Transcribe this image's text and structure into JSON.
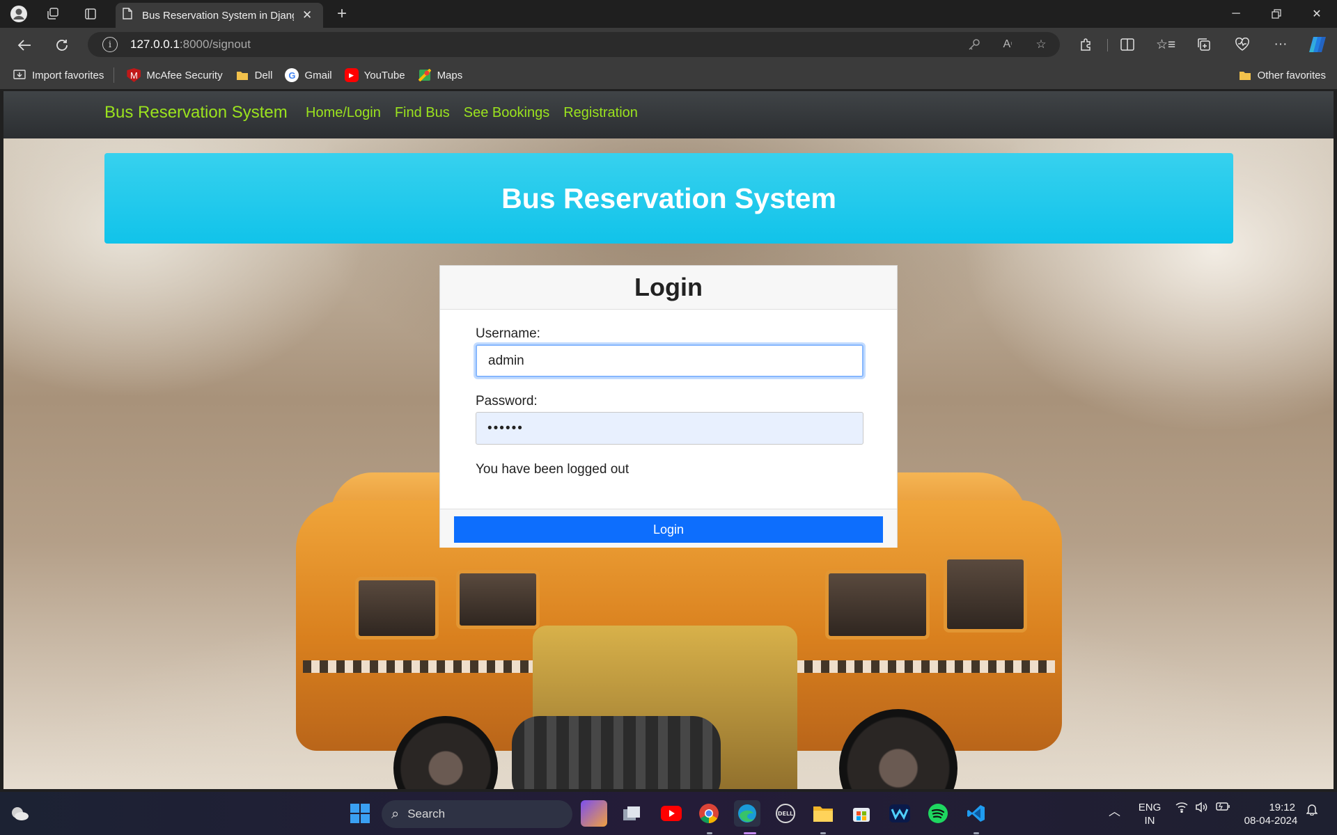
{
  "browser": {
    "tab_title": "Bus Reservation System in Djang",
    "url_host": "127.0.0.1",
    "url_rest": ":8000/signout",
    "favorites": [
      {
        "label": "Import favorites",
        "icon": "import-icon"
      },
      {
        "label": "McAfee Security",
        "icon": "mcafee-icon"
      },
      {
        "label": "Dell",
        "icon": "folder-icon"
      },
      {
        "label": "Gmail",
        "icon": "google-icon"
      },
      {
        "label": "YouTube",
        "icon": "youtube-icon"
      },
      {
        "label": "Maps",
        "icon": "maps-icon"
      }
    ],
    "other_favorites": "Other favorites"
  },
  "navbar": {
    "brand": "Bus Reservation System",
    "links": [
      "Home/Login",
      "Find Bus",
      "See Bookings",
      "Registration"
    ],
    "link_color": "#9be31e"
  },
  "hero": {
    "title": "Bus Reservation System",
    "color": "#11c3ea"
  },
  "login": {
    "title": "Login",
    "username_label": "Username:",
    "username_value": "admin",
    "password_label": "Password:",
    "password_value": "••••••",
    "message": "You have been logged out",
    "button_label": "Login",
    "button_color": "#0d6efd"
  },
  "taskbar": {
    "search_label": "Search",
    "lang_line1": "ENG",
    "lang_line2": "IN",
    "time": "19:12",
    "date": "08-04-2024"
  }
}
